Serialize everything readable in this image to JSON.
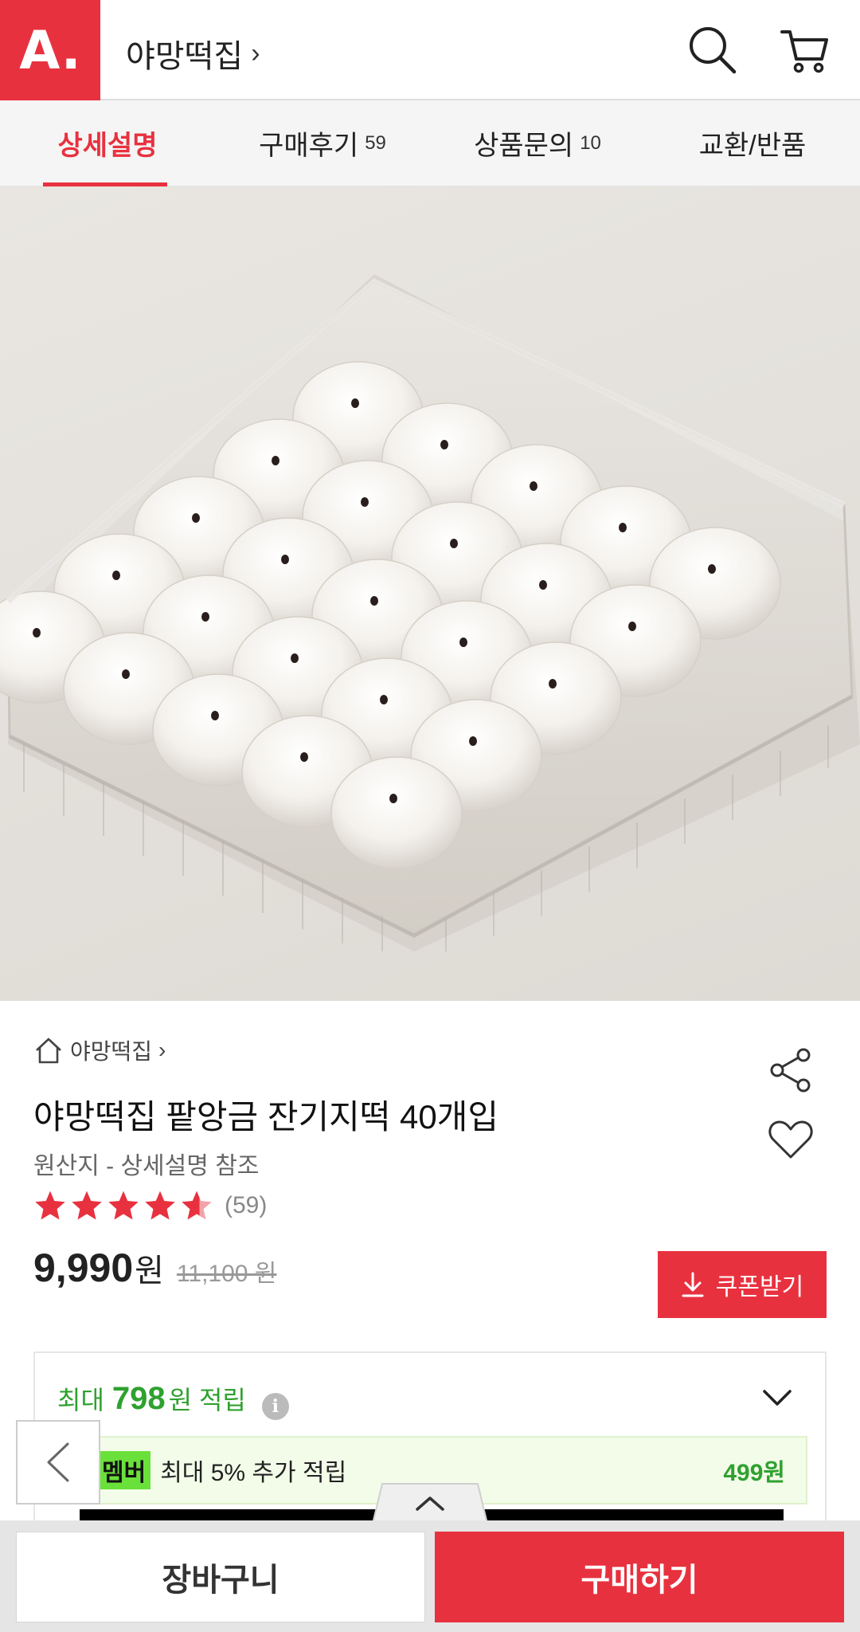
{
  "header": {
    "logo_text": "A.",
    "store_name": "야망떡집",
    "chevron": "›",
    "icons": [
      "search-icon",
      "cart-icon"
    ]
  },
  "tabs": [
    {
      "label": "상세설명",
      "count": ""
    },
    {
      "label": "구매후기",
      "count": "59"
    },
    {
      "label": "상품문의",
      "count": "10"
    },
    {
      "label": "교환/반품",
      "count": ""
    }
  ],
  "product": {
    "breadcrumb": "야망떡집",
    "breadcrumb_chevron": "›",
    "title": "야망떡집 팥앙금 잔기지떡 40개입",
    "origin": "원산지 - 상세설명 참조",
    "rating": 4.5,
    "review_count": "(59)",
    "price": "9,990",
    "price_unit": "원",
    "original_price": "11,100 원",
    "coupon_label": "쿠폰받기"
  },
  "points": {
    "prefix": "최대",
    "amount": "798",
    "suffix": "원 적립",
    "info_glyph": "i",
    "member_badge": "멤버",
    "member_text": "최대 5% 추가 적립",
    "member_amount": "499원"
  },
  "bottom": {
    "cart_label": "장바구니",
    "buy_label": "구매하기"
  },
  "colors": {
    "brand_red": "#e8313f",
    "points_green": "#2fa12f"
  }
}
